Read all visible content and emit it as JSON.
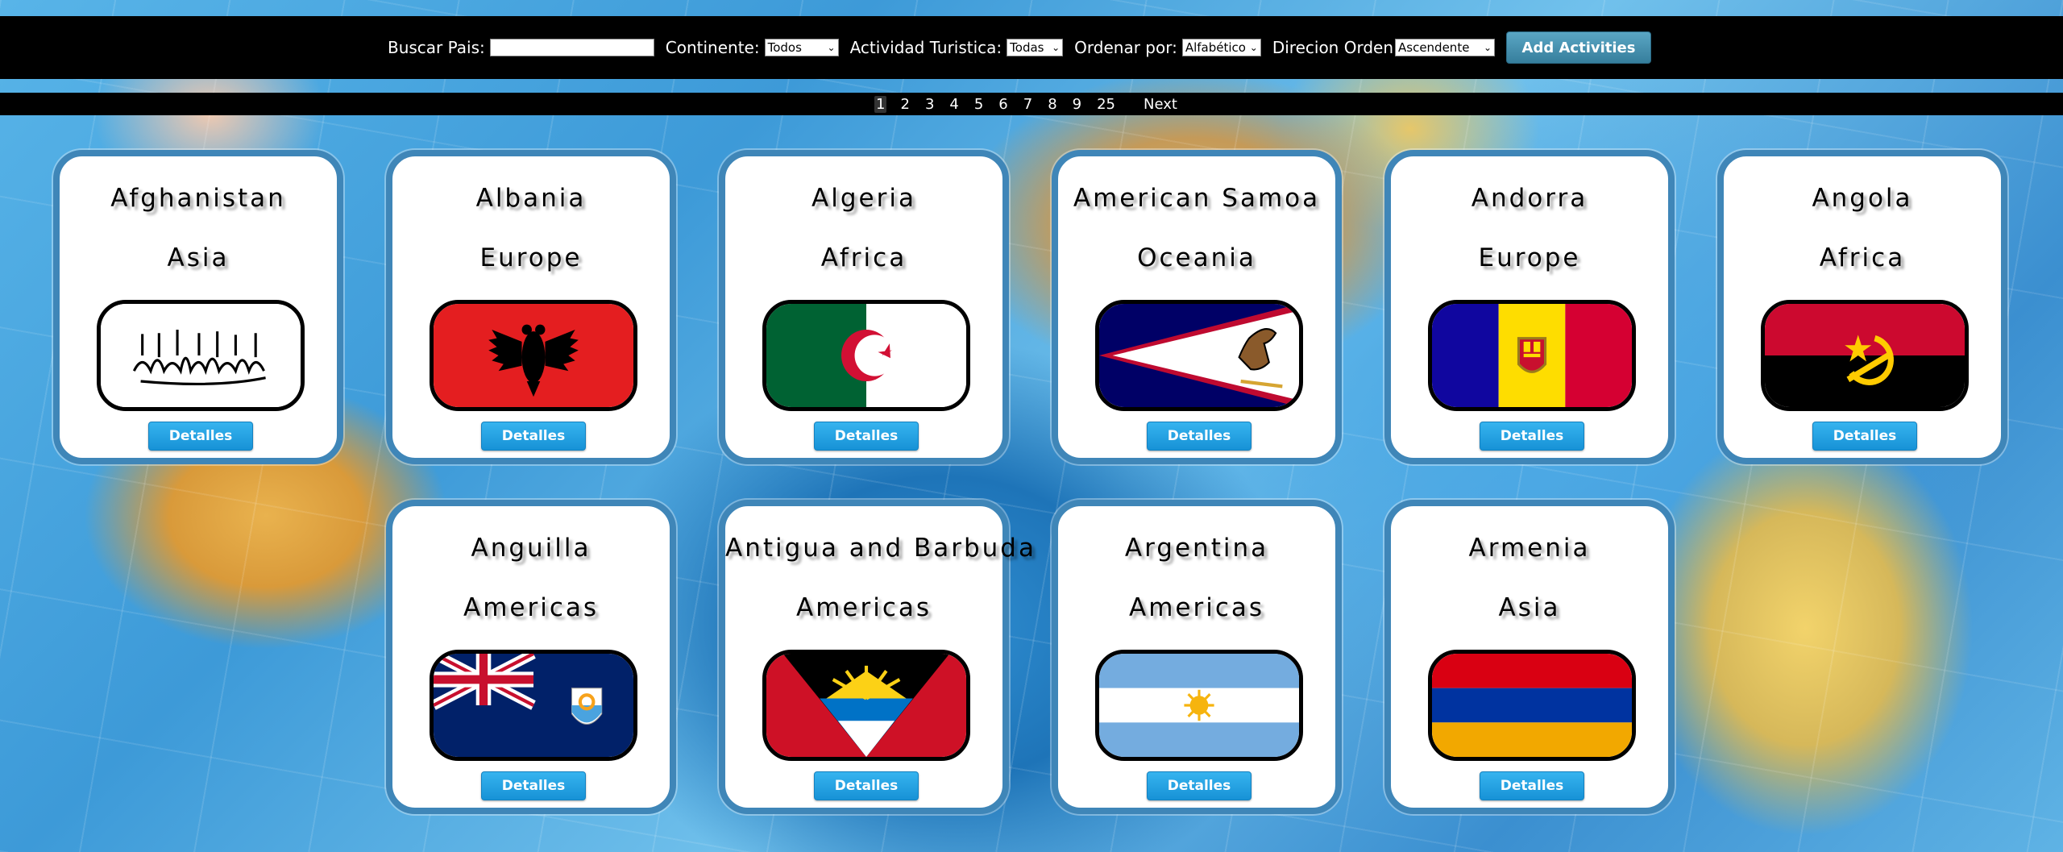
{
  "navbar": {
    "search_label": "Buscar Pais:",
    "search_value": "",
    "continent_label": "Continente:",
    "continent_value": "Todos",
    "activity_label": "Actividad Turistica:",
    "activity_value": "Todas",
    "order_label": "Ordenar por:",
    "order_value": "Alfabético",
    "direction_label": "Direcion Orden",
    "direction_value": "Ascendente",
    "add_button": "Add Activities"
  },
  "pagination": {
    "pages": [
      "1",
      "2",
      "3",
      "4",
      "5",
      "6",
      "7",
      "8",
      "9",
      "25"
    ],
    "active": "1",
    "next": "Next"
  },
  "cards": [
    {
      "name": "Afghanistan",
      "continent": "Asia",
      "flag": "flag-afghanistan",
      "button": "Detalles"
    },
    {
      "name": "Albania",
      "continent": "Europe",
      "flag": "flag-albania",
      "button": "Detalles"
    },
    {
      "name": "Algeria",
      "continent": "Africa",
      "flag": "flag-algeria",
      "button": "Detalles"
    },
    {
      "name": "American Samoa",
      "continent": "Oceania",
      "flag": "flag-american-samoa",
      "button": "Detalles"
    },
    {
      "name": "Andorra",
      "continent": "Europe",
      "flag": "flag-andorra",
      "button": "Detalles"
    },
    {
      "name": "Angola",
      "continent": "Africa",
      "flag": "flag-angola",
      "button": "Detalles"
    },
    {
      "name": "Anguilla",
      "continent": "Americas",
      "flag": "flag-anguilla",
      "button": "Detalles"
    },
    {
      "name": "Antigua and Barbuda",
      "continent": "Americas",
      "flag": "flag-antigua-and-barbuda",
      "button": "Detalles"
    },
    {
      "name": "Argentina",
      "continent": "Americas",
      "flag": "flag-argentina",
      "button": "Detalles"
    },
    {
      "name": "Armenia",
      "continent": "Asia",
      "flag": "flag-armenia",
      "button": "Detalles"
    }
  ]
}
